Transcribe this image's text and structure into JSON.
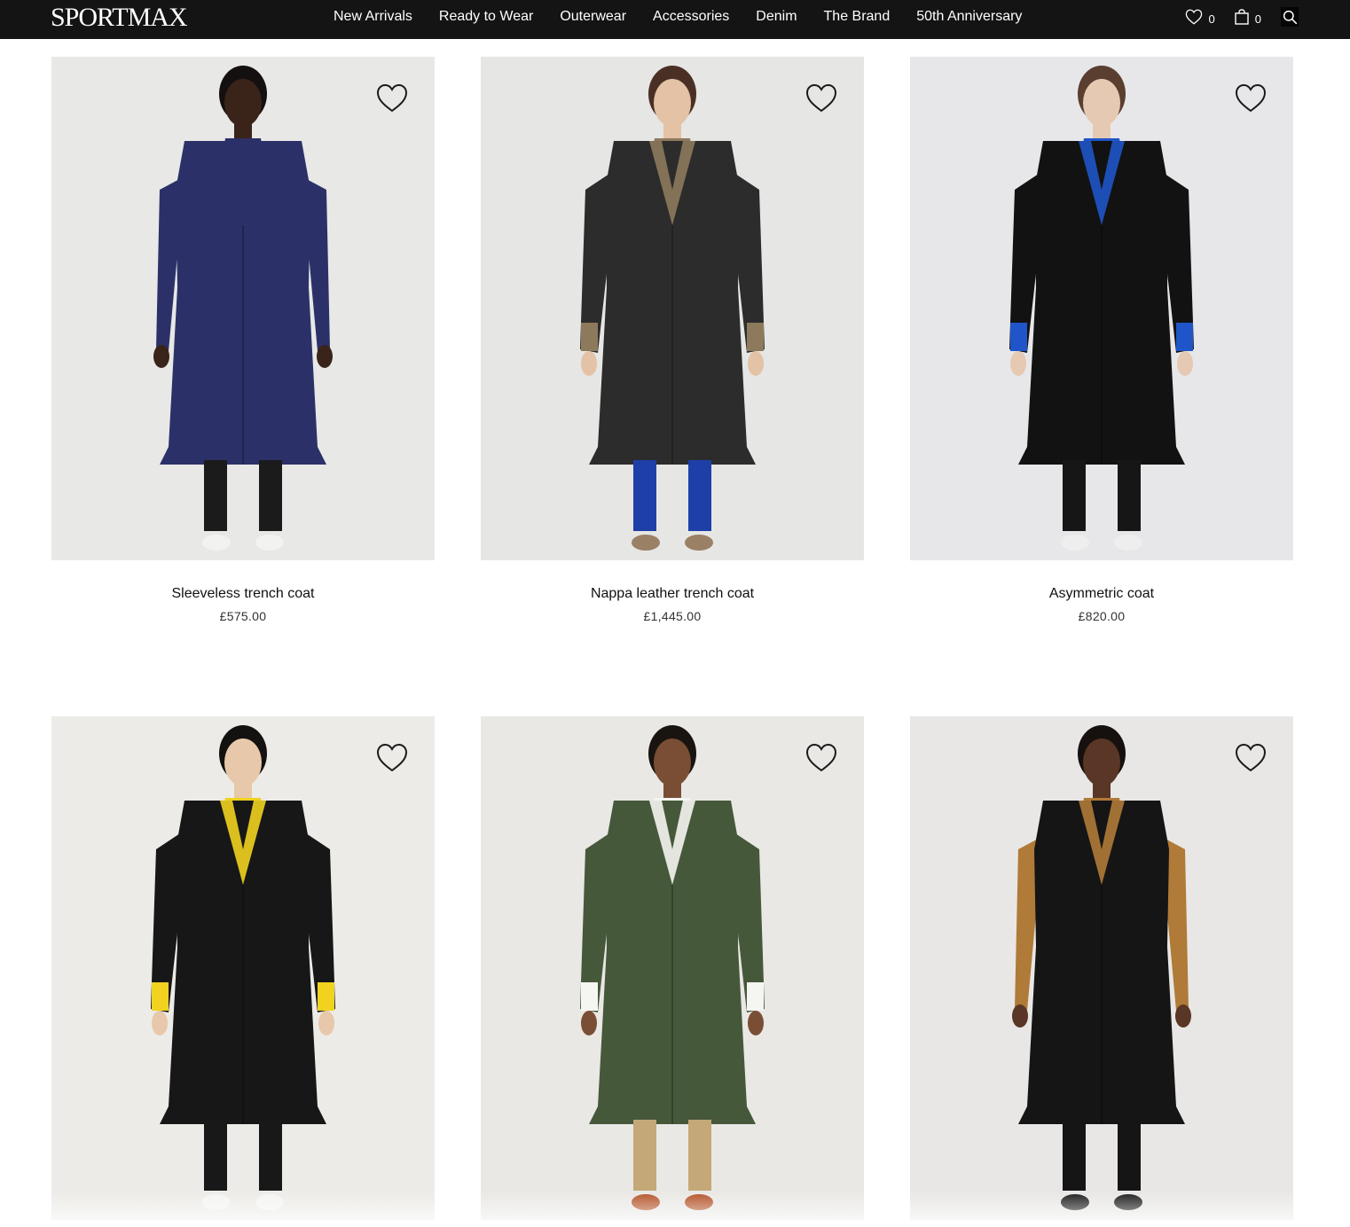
{
  "header": {
    "logo": "SPORTMAX",
    "nav": [
      "New Arrivals",
      "Ready to Wear",
      "Outerwear",
      "Accessories",
      "Denim",
      "The Brand",
      "50th Anniversary"
    ],
    "wishlist_count": "0",
    "bag_count": "0",
    "icons": [
      "heart-icon",
      "shopping-bag-icon",
      "search-icon"
    ]
  },
  "products": [
    {
      "name": "Sleeveless trench coat",
      "price": "£575.00",
      "bg": "#e8e8e6",
      "coat": "#2b3168",
      "skin": "#3a2419",
      "hair": "#151010",
      "legs": "#1b1b1b",
      "shoes": "#f2f2f0",
      "under": "#2b3168",
      "sleeveless": true
    },
    {
      "name": "Nappa leather trench coat",
      "price": "£1,445.00",
      "bg": "#e6e6e4",
      "coat": "#2c2c2c",
      "skin": "#e3c2a6",
      "hair": "#4a3024",
      "legs": "#1f3fa8",
      "shoes": "#9a8166",
      "under": "#8d7a5c",
      "sleeveless": false
    },
    {
      "name": "Asymmetric coat",
      "price": "£820.00",
      "bg": "#e7e7e9",
      "coat": "#121212",
      "skin": "#e6c9b2",
      "hair": "#5a3e30",
      "legs": "#161616",
      "shoes": "#eeeeee",
      "under": "#1f55c8",
      "sleeveless": false
    },
    {
      "name": "",
      "price": "",
      "bg": "#ecebe7",
      "coat": "#171717",
      "skin": "#e8c8aa",
      "hair": "#141210",
      "legs": "#181818",
      "shoes": "#f4f4f2",
      "under": "#f0d21f",
      "sleeveless": false
    },
    {
      "name": "",
      "price": "",
      "bg": "#e9e8e5",
      "coat": "#46583a",
      "skin": "#7a4e35",
      "hair": "#1a1410",
      "legs": "#c4a878",
      "shoes": "#b4542a",
      "under": "#f5f5f2",
      "sleeveless": false
    },
    {
      "name": "",
      "price": "",
      "bg": "#e8e7e5",
      "coat": "#151515",
      "skin": "#5a3626",
      "hair": "#16110e",
      "legs": "#151515",
      "shoes": "#1c1c1c",
      "under": "#b07a38",
      "sleeveless": true
    }
  ]
}
